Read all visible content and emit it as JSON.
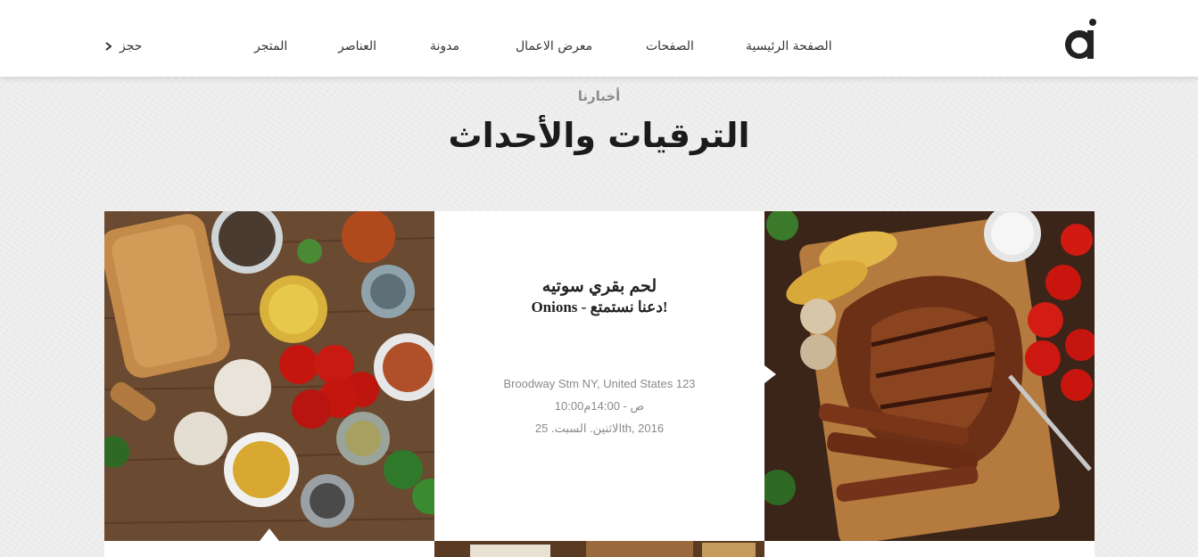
{
  "header": {
    "logo": "logo-a",
    "nav": [
      {
        "label": "الصفحة الرئيسية"
      },
      {
        "label": "الصفحات"
      },
      {
        "label": "معرض الاعمال"
      },
      {
        "label": "مدونة"
      },
      {
        "label": "العناصر"
      },
      {
        "label": "المتجر"
      }
    ],
    "book_label": "حجز",
    "book_icon": "chevron-right-icon"
  },
  "section": {
    "kicker": "أخبارنا",
    "title": "الترقيات والأحداث"
  },
  "event": {
    "title": "لحم بقري سوتيه",
    "subtitle": "Onions - دعنا نستمتع!",
    "address": "Broodway Stm NY, United States 123",
    "time": "10:00ص - 14:00م",
    "date": "الاثنين. السبت. 25th, 2016"
  },
  "images": {
    "left": "food-ingredients-photo",
    "right": "grilled-steak-photo"
  },
  "colors": {
    "header_bg": "#ffffff",
    "page_bg": "#ededed",
    "title": "#1b1b1b",
    "muted": "#8a8a8a"
  }
}
